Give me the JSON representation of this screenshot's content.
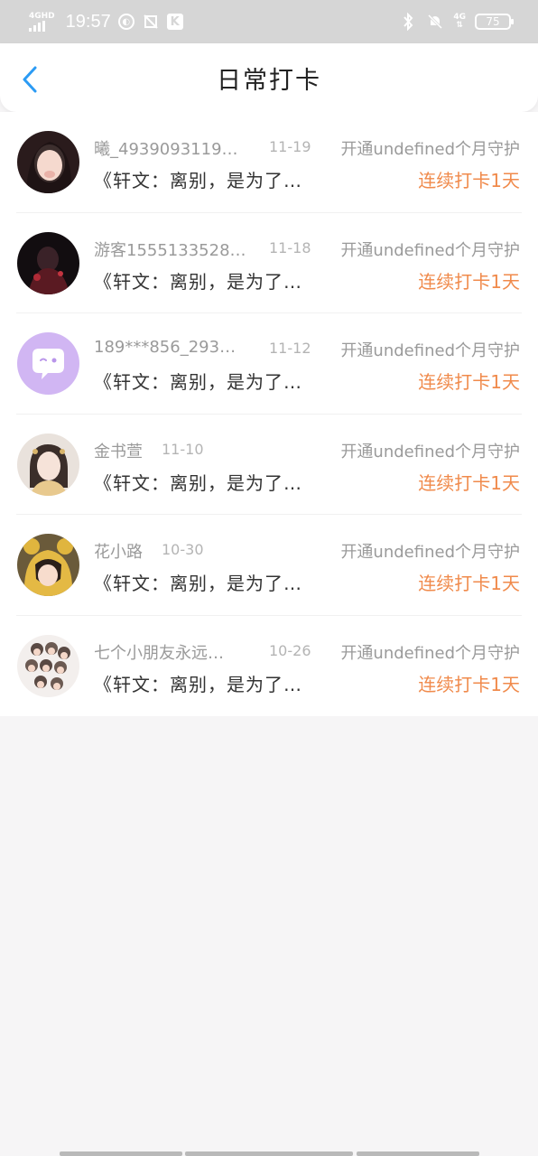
{
  "status_bar": {
    "network_label": "4GHD",
    "time": "19:57",
    "right_network": "4G",
    "battery": "75"
  },
  "header": {
    "title": "日常打卡"
  },
  "rows": [
    {
      "name": "曦_4939093119…",
      "date": "11-19",
      "guard": "开通undefined个月守护",
      "content": "《轩文：离别，是为了…",
      "streak": "连续打卡1天"
    },
    {
      "name": "游客1555133528…",
      "date": "11-18",
      "guard": "开通undefined个月守护",
      "content": "《轩文：离别，是为了…",
      "streak": "连续打卡1天"
    },
    {
      "name": "189***856_293…",
      "date": "11-12",
      "guard": "开通undefined个月守护",
      "content": "《轩文：离别，是为了…",
      "streak": "连续打卡1天"
    },
    {
      "name": "金书萱",
      "date": "11-10",
      "guard": "开通undefined个月守护",
      "content": "《轩文：离别，是为了…",
      "streak": "连续打卡1天"
    },
    {
      "name": "花小路",
      "date": "10-30",
      "guard": "开通undefined个月守护",
      "content": "《轩文：离别，是为了…",
      "streak": "连续打卡1天"
    },
    {
      "name": "七个小朋友永远…",
      "date": "10-26",
      "guard": "开通undefined个月守护",
      "content": "《轩文：离别，是为了…",
      "streak": "连续打卡1天"
    }
  ],
  "colors": {
    "accent_orange": "#f08a4b",
    "back_arrow_blue": "#2b9bf4",
    "chat_avatar_purple": "#d1b6f3"
  }
}
